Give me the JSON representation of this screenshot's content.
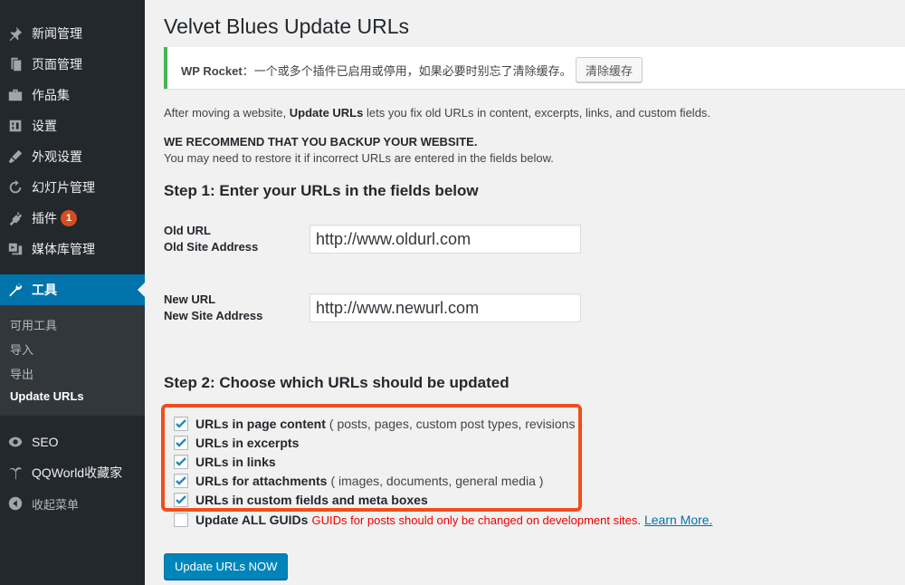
{
  "sidebar": {
    "items": [
      {
        "label": "新闻管理",
        "icon": "pushpin-icon"
      },
      {
        "label": "页面管理",
        "icon": "page-icon"
      },
      {
        "label": "作品集",
        "icon": "briefcase-icon"
      },
      {
        "label": "设置",
        "icon": "settings-icon"
      },
      {
        "label": "外观设置",
        "icon": "appearance-icon"
      },
      {
        "label": "幻灯片管理",
        "icon": "slider-icon"
      },
      {
        "label": "插件",
        "icon": "plugin-icon",
        "badge": "1"
      },
      {
        "label": "媒体库管理",
        "icon": "media-icon"
      },
      {
        "label": "工具",
        "icon": "wrench-icon"
      }
    ],
    "submenu": [
      "可用工具",
      "导入",
      "导出",
      "Update URLs"
    ],
    "bottom_items": [
      {
        "label": "SEO",
        "icon": "seo-icon"
      },
      {
        "label": "QQWorld收藏家",
        "icon": "palm-icon"
      },
      {
        "label": "收起菜单",
        "icon": "collapse-icon"
      }
    ]
  },
  "page": {
    "title": "Velvet Blues Update URLs",
    "notice": {
      "brand": "WP Rocket",
      "text": "：一个或多个插件已启用或停用，如果必要时别忘了清除缓存。",
      "button": "清除缓存"
    },
    "intro_prefix": "After moving a website, ",
    "intro_bold": "Update URLs",
    "intro_suffix": " lets you fix old URLs in content, excerpts, links, and custom fields.",
    "recommend": "WE RECOMMEND THAT YOU BACKUP YOUR WEBSITE.",
    "restore_note": "You may need to restore it if incorrect URLs are entered in the fields below.",
    "step1": "Step 1: Enter your URLs in the fields below",
    "old_url_label": "Old URL",
    "old_url_sub": "Old Site Address",
    "old_url_value": "http://www.oldurl.com",
    "new_url_label": "New URL",
    "new_url_sub": "New Site Address",
    "new_url_value": "http://www.newurl.com",
    "step2": "Step 2: Choose which URLs should be updated",
    "options": [
      {
        "label": "URLs in page content",
        "desc": " ( posts, pages, custom post types, revisions )",
        "checked": true
      },
      {
        "label": "URLs in excerpts",
        "desc": "",
        "checked": true
      },
      {
        "label": "URLs in links",
        "desc": "",
        "checked": true
      },
      {
        "label": "URLs for attachments",
        "desc": " ( images, documents, general media )",
        "checked": true
      },
      {
        "label": "URLs in custom fields and meta boxes",
        "desc": "",
        "checked": true
      }
    ],
    "guid": {
      "label": "Update ALL GUIDs",
      "warning": "GUIDs for posts should only be changed on development sites.",
      "link": "Learn More.",
      "checked": false
    },
    "submit": "Update URLs NOW"
  },
  "colors": {
    "sidebar_bg": "#23282d",
    "active_menu": "#0073aa",
    "highlight": "#f04d1d",
    "notice_border": "#46b450",
    "button": "#0085ba"
  }
}
